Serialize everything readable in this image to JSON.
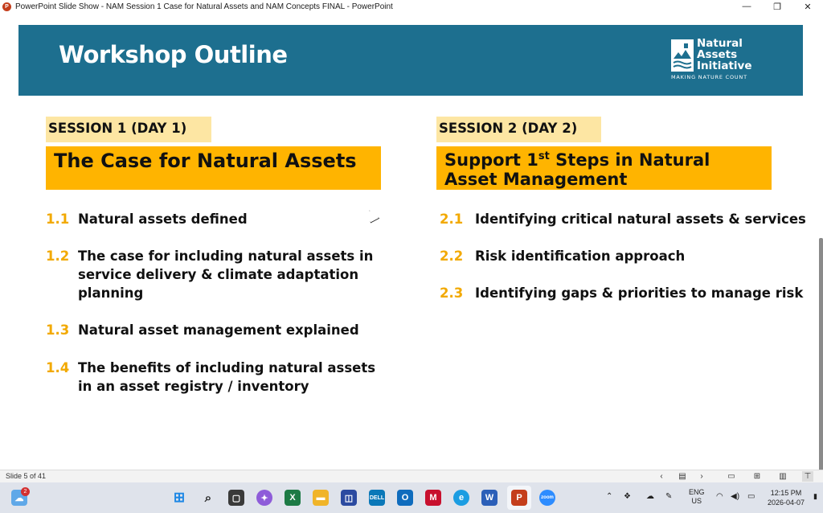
{
  "window": {
    "title": "PowerPoint Slide Show  -  NAM Session 1 Case for Natural Assets and NAM Concepts FINAL - PowerPoint",
    "minimize_icon": "—",
    "restore_icon": "❐",
    "close_icon": "✕"
  },
  "slide": {
    "title": "Workshop Outline",
    "logo": {
      "line1": "Natural",
      "line2": "Assets",
      "line3": "Initiative",
      "tagline": "MAKING NATURE COUNT"
    },
    "session1": {
      "label": "SESSION 1 (DAY 1)",
      "title": "The Case for Natural Assets",
      "items": [
        {
          "num": "1.1",
          "text": "Natural assets defined"
        },
        {
          "num": "1.2",
          "text": "The case for including natural assets in service delivery & climate adaptation planning"
        },
        {
          "num": "1.3",
          "text": "Natural asset management explained"
        },
        {
          "num": "1.4",
          "text": "The benefits of including natural assets in an asset registry / inventory"
        }
      ]
    },
    "session2": {
      "label": "SESSION 2 (DAY 2)",
      "title_part1": "Support 1",
      "title_sup": "st",
      "title_part2": " Steps in Natural Asset Management",
      "items": [
        {
          "num": "2.1",
          "text": "Identifying critical natural assets & services"
        },
        {
          "num": "2.2",
          "text": "Risk identification approach"
        },
        {
          "num": "2.3",
          "text": "Identifying gaps & priorities to manage risk"
        }
      ]
    }
  },
  "statusbar": {
    "slide_count": "Slide 5 of 41"
  },
  "taskbar": {
    "notification_count": "2",
    "language_line1": "ENG",
    "language_line2": "US",
    "time": "12:15 PM",
    "date": "2026-04-07"
  },
  "colors": {
    "header_band": "#1d6f8f",
    "session_label_bg": "#fde6a3",
    "session_title_bg": "#ffb400",
    "number_accent": "#f2a900"
  }
}
